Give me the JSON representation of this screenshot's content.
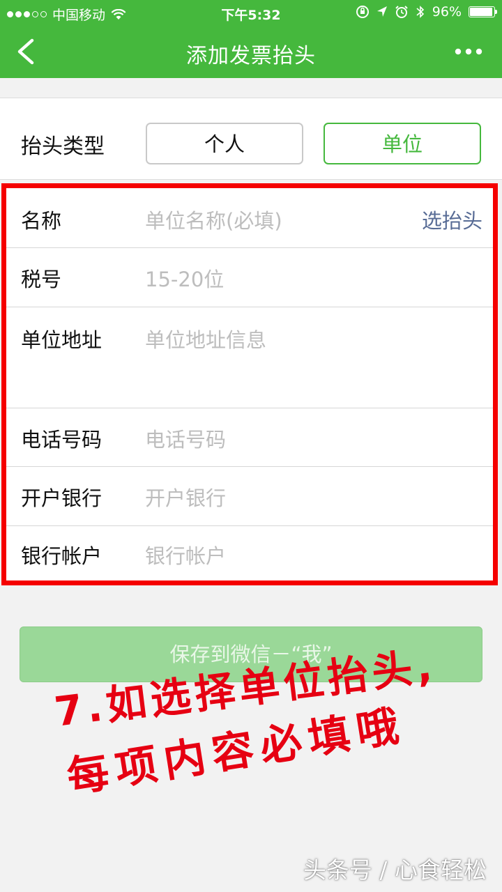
{
  "status_bar": {
    "carrier": "中国移动",
    "time": "下午5:32",
    "battery": "96%",
    "battery_level": 0.96
  },
  "nav": {
    "title": "添加发票抬头",
    "back_icon": "chevron-left-icon",
    "more_icon": "more-dots-icon"
  },
  "type_row": {
    "label": "抬头类型",
    "options": [
      "个人",
      "单位"
    ],
    "selected": "单位"
  },
  "form": {
    "fields": [
      {
        "label": "名称",
        "placeholder": "单位名称(必填)"
      },
      {
        "label": "税号",
        "placeholder": "15-20位"
      },
      {
        "label": "单位地址",
        "placeholder": "单位地址信息"
      },
      {
        "label": "电话号码",
        "placeholder": "电话号码"
      },
      {
        "label": "开户银行",
        "placeholder": "开户银行"
      },
      {
        "label": "银行帐户",
        "placeholder": "银行帐户"
      }
    ],
    "pick_title": "选抬头"
  },
  "save_button": "保存到微信－“我”",
  "annotation": {
    "line1": "7.如选择单位抬头,",
    "line2": "每项内容必填哦"
  },
  "watermark": "头条号 / 心食轻松",
  "colors": {
    "brand_green": "#45b83d",
    "highlight_red": "#f50000",
    "link_blue": "#576b95"
  }
}
